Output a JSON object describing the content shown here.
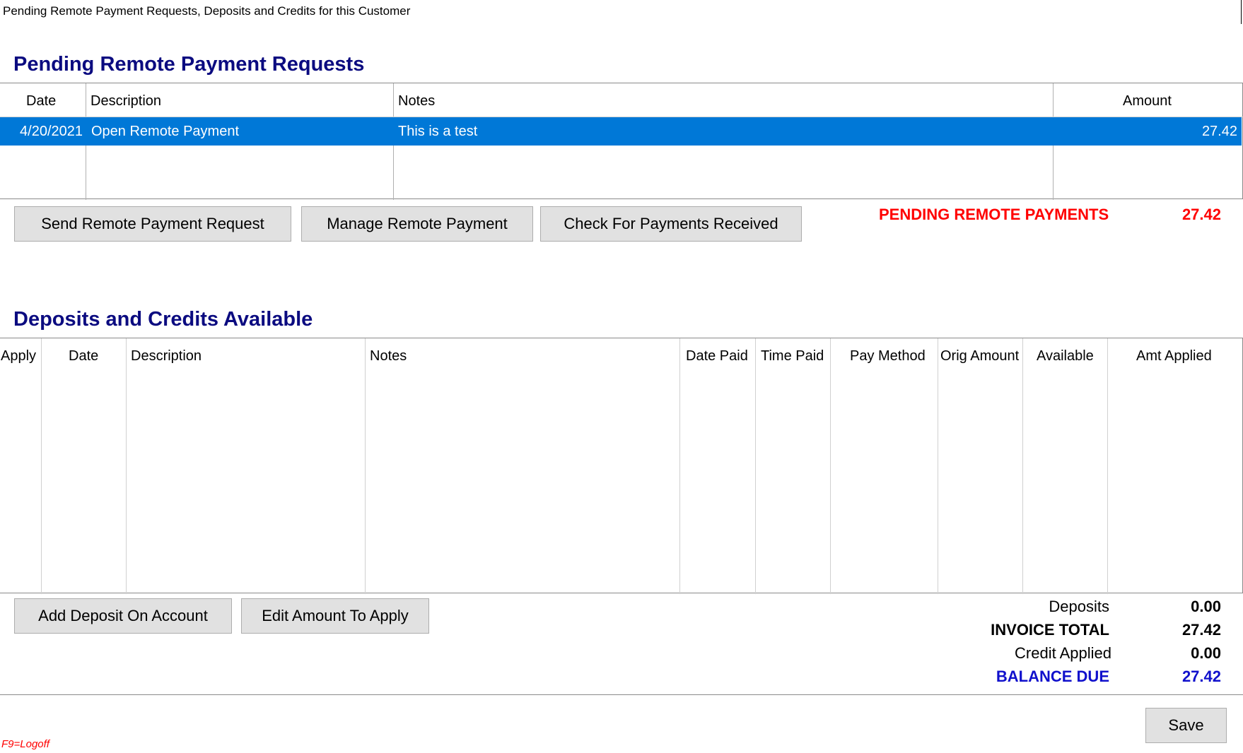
{
  "window": {
    "title": "Pending Remote Payment Requests, Deposits and Credits for this Customer"
  },
  "pending": {
    "title": "Pending Remote Payment Requests",
    "columns": {
      "date": "Date",
      "description": "Description",
      "notes": "Notes",
      "amount": "Amount"
    },
    "rows": [
      {
        "date": "4/20/2021",
        "description": "Open Remote Payment",
        "notes": "This is a test",
        "amount": "27.42",
        "selected": true
      }
    ],
    "buttons": {
      "send": "Send Remote Payment Request",
      "manage": "Manage Remote Payment",
      "check": "Check For Payments Received"
    },
    "total_label": "PENDING REMOTE PAYMENTS",
    "total_value": "27.42",
    "total_color": "#ff0000"
  },
  "deposits": {
    "title": "Deposits and Credits Available",
    "columns": {
      "apply": "Apply",
      "date": "Date",
      "description": "Description",
      "notes": "Notes",
      "date_paid": "Date Paid",
      "time_paid": "Time Paid",
      "pay_method": "Pay Method",
      "orig_amount": "Orig Amount",
      "available": "Available",
      "amt_applied": "Amt Applied"
    },
    "rows": [],
    "buttons": {
      "add_deposit": "Add Deposit On Account",
      "edit_amount": "Edit Amount To Apply"
    }
  },
  "totals": {
    "deposits_label": "Deposits",
    "deposits_value": "0.00",
    "invoice_total_label": "INVOICE TOTAL",
    "invoice_total_value": "27.42",
    "credit_applied_label": "Credit Applied",
    "credit_applied_value": "0.00",
    "balance_due_label": "BALANCE DUE",
    "balance_due_value": "27.42",
    "balance_due_color": "#1010cc"
  },
  "footer": {
    "save_label": "Save",
    "logoff_hint": "F9=Logoff"
  },
  "colors": {
    "section_title": "#0b0b80",
    "selection": "#0078d7"
  }
}
